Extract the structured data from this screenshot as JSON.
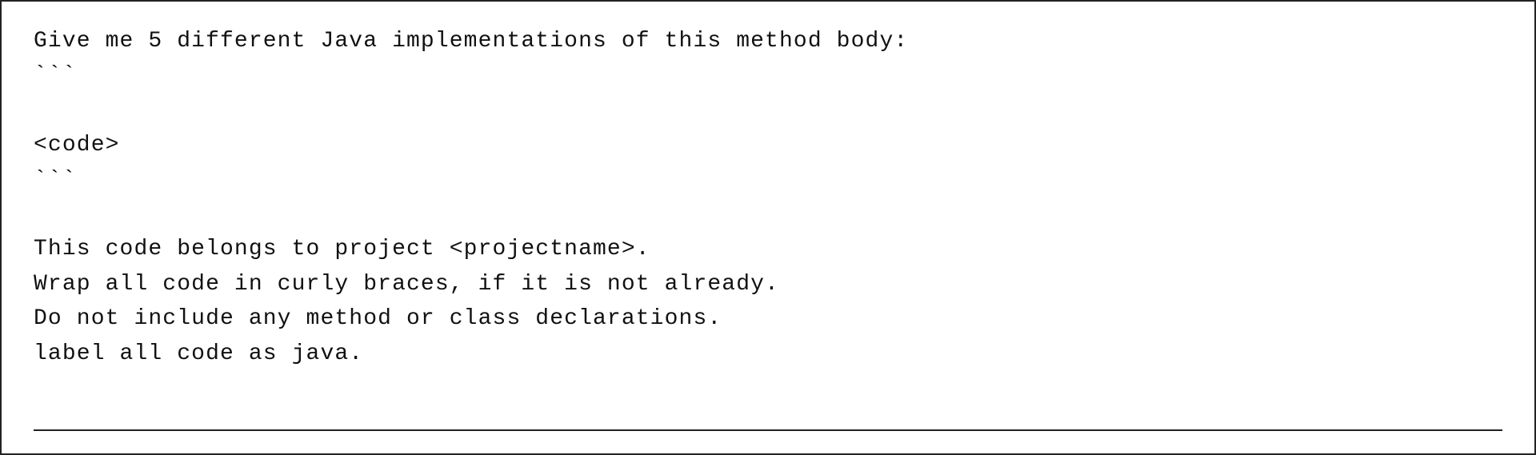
{
  "content": {
    "lines": [
      "Give me 5 different Java implementations of this method body:",
      "‘‘‘",
      "",
      "<code>",
      "‘‘‘",
      "",
      "This code belongs to project <projectname>.",
      "Wrap all code in curly braces, if it is not already.",
      "Do not include any method or class declarations.",
      "label all code as java."
    ]
  }
}
